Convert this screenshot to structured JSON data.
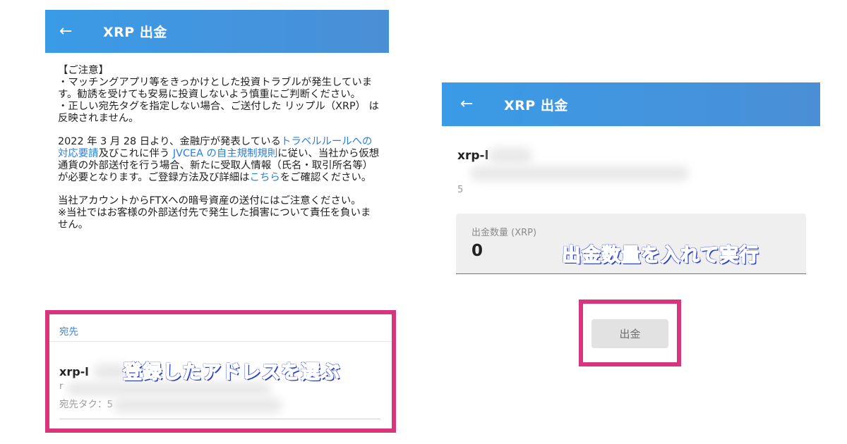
{
  "left": {
    "appbar": {
      "back_icon": "←",
      "title": "XRP 出金"
    },
    "notice": {
      "p1": "【ご注意】\n・マッチングアプリ等をきっかけとした投資トラブルが発生しています。勧誘を受けても安易に投資しないよう慎重にご判断ください。\n・正しい宛先タグを指定しない場合、ご送付した リップル（XRP） は反映されません。",
      "p2_pre": "2022 年 3 月 28 日より、金融庁が発表している",
      "p2_link1": "トラベルルールへの対応要請",
      "p2_mid": "及びこれに伴う ",
      "p2_link2": "JVCEA の自主規制規則",
      "p2_post": "に従い、当社から仮想通貨の外部送付を行う場合、新たに受取人情報（氏名・取引所名等）が必要となります。ご登録方法及び詳細は",
      "p2_link3": "こちら",
      "p2_end": "をご確認ください。",
      "p3": "当社アカウントからFTXへの暗号資産の送付にはご注意ください。\n※当社ではお客様の外部送付先で発生した損害について責任を負いません。"
    },
    "destination": {
      "label": "宛先",
      "name": "xrp-l",
      "address": "r",
      "tag": "宛先タク：5"
    },
    "callout": "登録したアドレスを選ぶ"
  },
  "right": {
    "appbar": {
      "back_icon": "←",
      "title": "XRP 出金"
    },
    "name": "xrp-l",
    "address": "5",
    "amount": {
      "label": "出金数量 (XRP)",
      "value": "0"
    },
    "callout": "出金数量を入れて実行",
    "button": "出金"
  },
  "colors": {
    "appbar": "#3a9be6",
    "highlight": "#d9357c",
    "link": "#2d7fd6"
  }
}
